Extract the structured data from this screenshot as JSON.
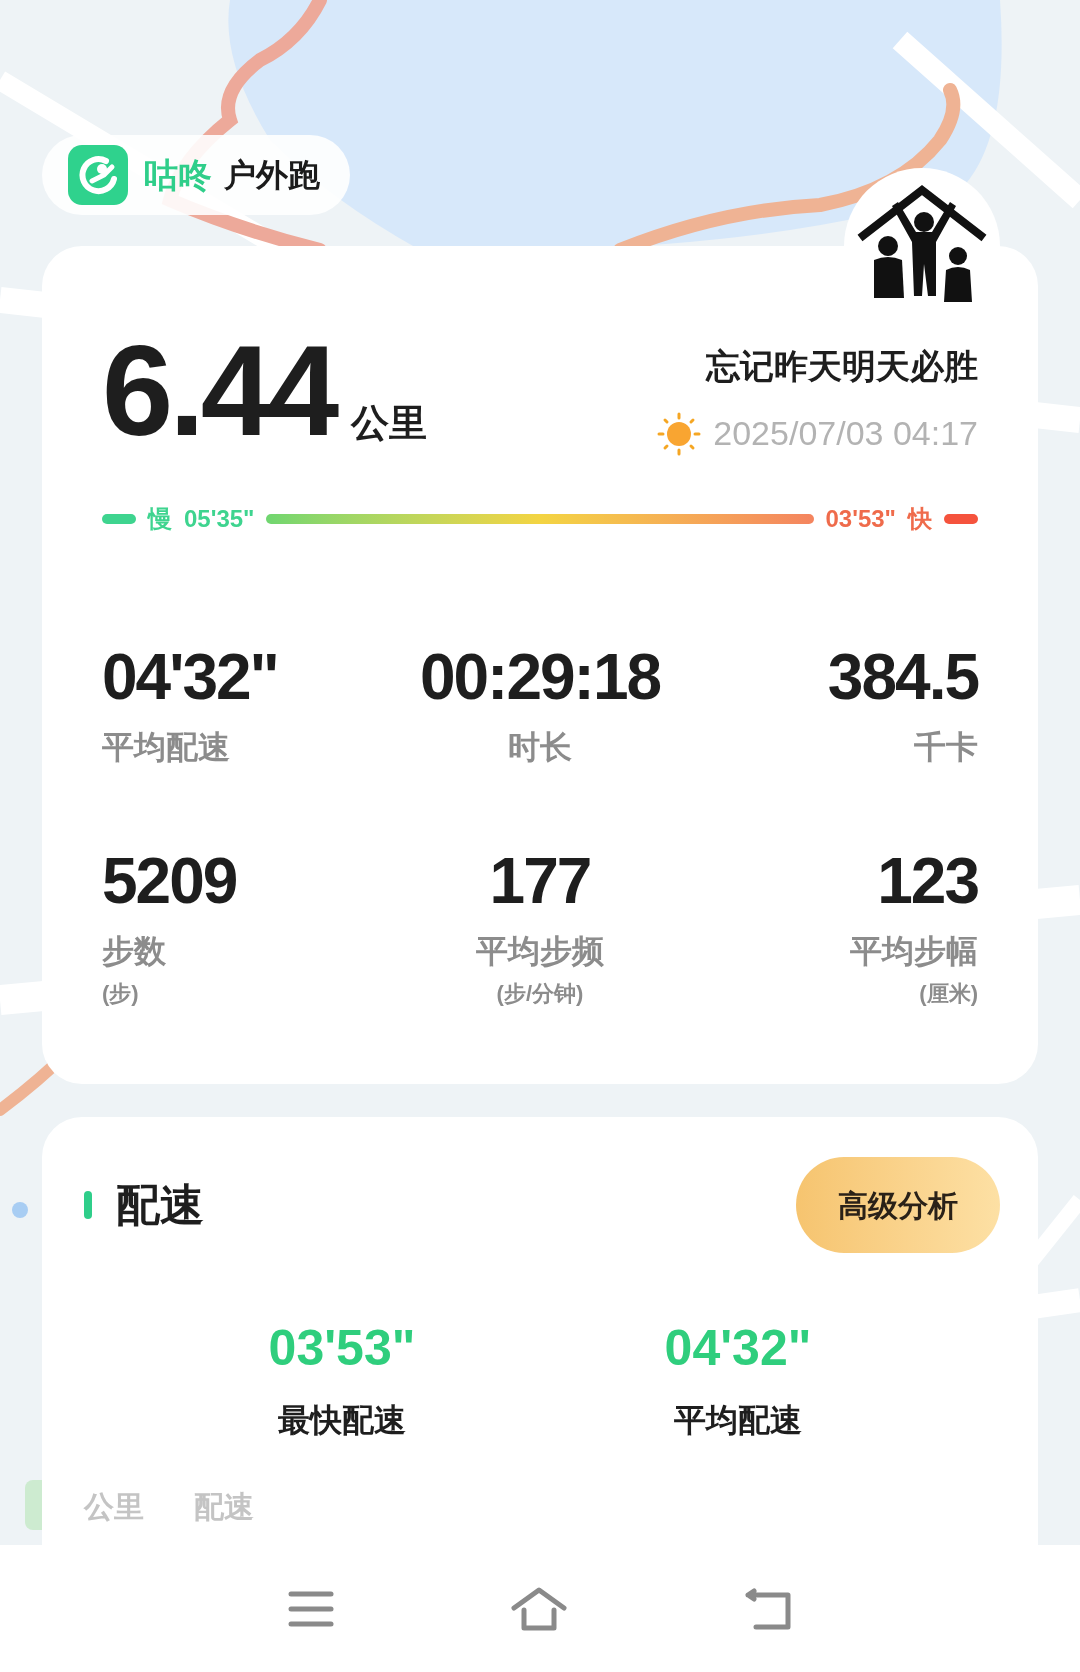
{
  "app_badge": {
    "brand": "咕咚",
    "mode": "户外跑"
  },
  "summary": {
    "distance": "6.44",
    "distance_unit": "公里",
    "title": "忘记昨天明天必胜",
    "date": "2025/07/03 04:17",
    "pace_range": {
      "slow_label": "慢",
      "slow_value": "05'35\"",
      "fast_value": "03'53\"",
      "fast_label": "快"
    }
  },
  "stats": [
    {
      "value": "04'32\"",
      "label": "平均配速"
    },
    {
      "value": "00:29:18",
      "label": "时长"
    },
    {
      "value": "384.5",
      "label": "千卡"
    },
    {
      "value": "5209",
      "label": "步数",
      "unit": "(步)"
    },
    {
      "value": "177",
      "label": "平均步频",
      "unit": "(步/分钟)"
    },
    {
      "value": "123",
      "label": "平均步幅",
      "unit": "(厘米)"
    }
  ],
  "pace_section": {
    "title": "配速",
    "button": "高级分析",
    "highlights": [
      {
        "value": "03'53\"",
        "label": "最快配速"
      },
      {
        "value": "04'32\"",
        "label": "平均配速"
      }
    ],
    "columns": [
      "公里",
      "配速"
    ]
  }
}
